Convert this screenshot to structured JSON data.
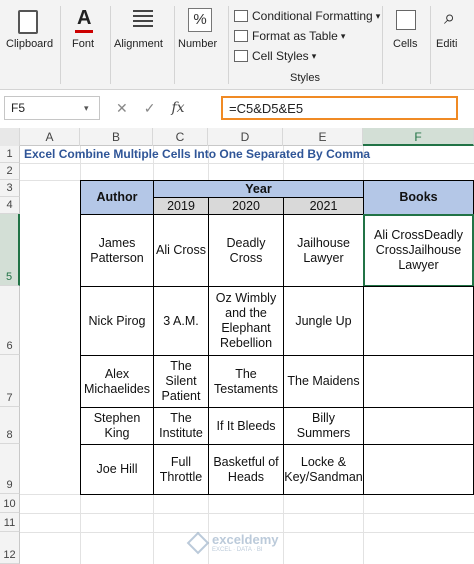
{
  "ribbon": {
    "clipboard": "Clipboard",
    "font": "Font",
    "alignment": "Alignment",
    "number": "Number",
    "cond_format": "Conditional Formatting",
    "format_table": "Format as Table",
    "cell_styles": "Cell Styles",
    "styles_group": "Styles",
    "cells": "Cells",
    "editing": "Editi",
    "number_symbol": "%"
  },
  "formula_bar": {
    "name_box": "F5",
    "formula": "=C5&D5&E5"
  },
  "columns": [
    "A",
    "B",
    "C",
    "D",
    "E",
    "F"
  ],
  "rows": [
    "1",
    "2",
    "3",
    "4",
    "5",
    "6",
    "7",
    "8",
    "9",
    "10",
    "11",
    "12"
  ],
  "sheet": {
    "title": "Excel Combine Multiple Cells Into One Separated By Comma",
    "author_header": "Author",
    "year_header": "Year",
    "books_header": "Books",
    "years": [
      "2019",
      "2020",
      "2021"
    ],
    "records": [
      {
        "author": "James Patterson",
        "y2019": "Ali Cross",
        "y2020": "Deadly Cross",
        "y2021": "Jailhouse Lawyer",
        "books": "Ali CrossDeadly CrossJailhouse Lawyer"
      },
      {
        "author": "Nick Pirog",
        "y2019": "3 A.M.",
        "y2020": "Oz Wimbly and the Elephant Rebellion",
        "y2021": "Jungle Up",
        "books": ""
      },
      {
        "author": "Alex Michaelides",
        "y2019": "The Silent Patient",
        "y2020": "The Testaments",
        "y2021": "The Maidens",
        "books": ""
      },
      {
        "author": "Stephen King",
        "y2019": "The Institute",
        "y2020": "If It Bleeds",
        "y2021": "Billy Summers",
        "books": ""
      },
      {
        "author": "Joe Hill",
        "y2019": "Full Throttle",
        "y2020": "Basketful of Heads",
        "y2021": "Locke & Key/Sandman",
        "books": ""
      }
    ]
  },
  "watermark": {
    "brand": "exceldemy",
    "tagline": "EXCEL · DATA · BI"
  },
  "colors": {
    "header_blue": "#b4c7e7",
    "year_gray": "#d9d9d9",
    "title_blue": "#2f5597",
    "formula_border": "#f08a24",
    "selection_green": "#217346"
  }
}
